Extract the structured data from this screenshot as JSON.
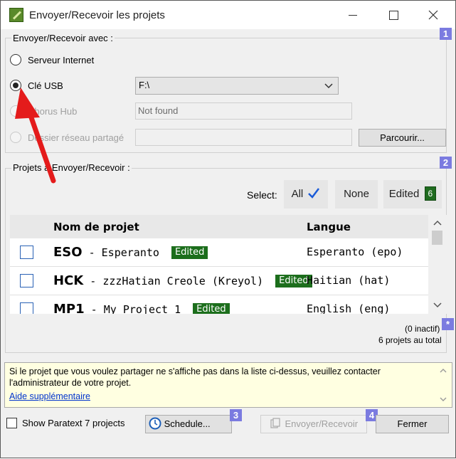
{
  "window": {
    "title": "Envoyer/Recevoir les projets"
  },
  "group1": {
    "label": "Envoyer/Recevoir avec :",
    "badge": "1",
    "options": [
      {
        "label": "Serveur Internet"
      },
      {
        "label": "Clé USB"
      },
      {
        "label": "Chorus Hub"
      },
      {
        "label": "Dossier réseau partagé"
      }
    ],
    "usb_drive": "F:\\",
    "chorus_value": "Not found",
    "browse_label": "Parcourir..."
  },
  "group2": {
    "label": "Projets à Envoyer/Recevoir :",
    "badge": "2",
    "select_label": "Select:",
    "all_label": "All",
    "none_label": "None",
    "edited_label": "Edited",
    "edited_count": "6",
    "headers": {
      "name": "Nom de projet",
      "lang": "Langue"
    },
    "rows": [
      {
        "code": "ESO",
        "name": "Esperanto",
        "tag": "Edited",
        "lang": "Esperanto (epo)"
      },
      {
        "code": "HCK",
        "name": "zzzHatian Creole (Kreyol)",
        "tag": "Edited",
        "lang": "Haitian (hat)"
      },
      {
        "code": "MP1",
        "name": "My Project 1",
        "tag": "Edited",
        "lang": "English (eng)"
      }
    ],
    "inactive": "(0 inactif)",
    "total": "6 projets au total",
    "star_badge": "*"
  },
  "note": {
    "text": "Si le projet que vous voulez partager ne s'affiche pas dans la liste ci-dessus, veuillez contacter l'administrateur de votre projet.",
    "link": "Aide supplémentaire"
  },
  "footer": {
    "show_p7": "Show Paratext 7 projects",
    "schedule": "Schedule...",
    "badge3": "3",
    "send_receive": "Envoyer/Recevoir",
    "badge4": "4",
    "close": "Fermer"
  }
}
